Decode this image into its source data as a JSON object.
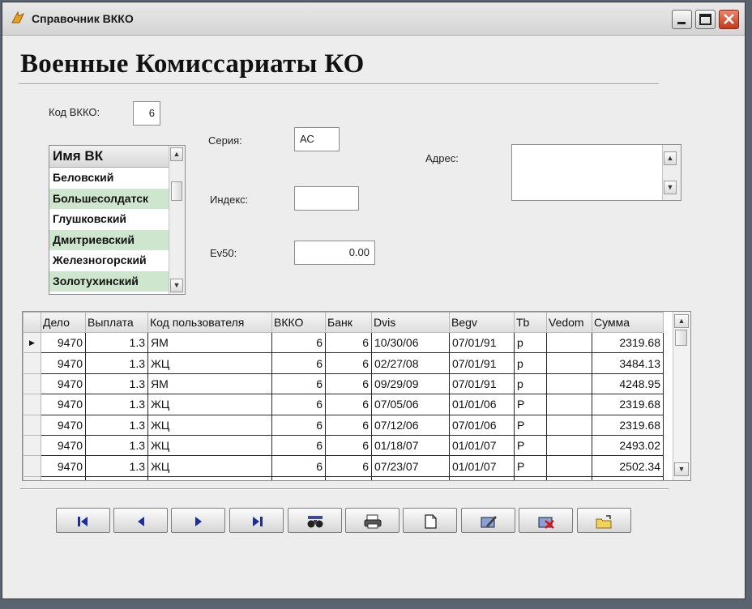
{
  "window": {
    "title": "Справочник ВККО",
    "icons": {
      "app": "app-flame-icon",
      "minimize": "minimize-icon",
      "maximize": "maximize-icon",
      "close": "close-icon"
    }
  },
  "form": {
    "heading": "Военные Комиссариаты КО",
    "code_label": "Код ВККО:",
    "code_value": "6",
    "series_label": "Серия:",
    "series_value": "АС",
    "index_label": "Индекс:",
    "index_value": "",
    "ev50_label": "Ev50:",
    "ev50_value": "0.00",
    "address_label": "Адрес:",
    "address_value": ""
  },
  "vk_list": {
    "header": "Имя ВК",
    "items": [
      "Беловский",
      "Большесолдатск",
      "Глушковский",
      "Дмитриевский",
      "Железногорский",
      "Золотухинский"
    ]
  },
  "grid": {
    "columns": [
      "Дело",
      "Выплата",
      "Код пользователя",
      "ВККО",
      "Банк",
      "Dvis",
      "Begv",
      "Tb",
      "Vedom",
      "Сумма"
    ],
    "rows": [
      [
        "9470",
        "1.3",
        "ЯМ",
        "6",
        "6",
        "10/30/06",
        "07/01/91",
        "р",
        "",
        "2319.68"
      ],
      [
        "9470",
        "1.3",
        "ЖЦ",
        "6",
        "6",
        "02/27/08",
        "07/01/91",
        "р",
        "",
        "3484.13"
      ],
      [
        "9470",
        "1.3",
        "ЯМ",
        "6",
        "6",
        "09/29/09",
        "07/01/91",
        "р",
        "",
        "4248.95"
      ],
      [
        "9470",
        "1.3",
        "ЖЦ",
        "6",
        "6",
        "07/05/06",
        "01/01/06",
        "Р",
        "",
        "2319.68"
      ],
      [
        "9470",
        "1.3",
        "ЖЦ",
        "6",
        "6",
        "07/12/06",
        "07/01/06",
        "Р",
        "",
        "2319.68"
      ],
      [
        "9470",
        "1.3",
        "ЖЦ",
        "6",
        "6",
        "01/18/07",
        "01/01/07",
        "Р",
        "",
        "2493.02"
      ],
      [
        "9470",
        "1.3",
        "ЖЦ",
        "6",
        "6",
        "07/23/07",
        "01/01/07",
        "Р",
        "",
        "2502.34"
      ],
      [
        "",
        "",
        "",
        "",
        "",
        "",
        "",
        "",
        "",
        ""
      ]
    ]
  },
  "toolbar": {
    "buttons": [
      {
        "name": "first-record-button",
        "icon": "first-record-icon"
      },
      {
        "name": "prev-record-button",
        "icon": "prev-record-icon"
      },
      {
        "name": "next-record-button",
        "icon": "next-record-icon"
      },
      {
        "name": "last-record-button",
        "icon": "last-record-icon"
      },
      {
        "name": "find-button",
        "icon": "binoculars-icon"
      },
      {
        "name": "print-button",
        "icon": "printer-icon"
      },
      {
        "name": "new-record-button",
        "icon": "new-document-icon"
      },
      {
        "name": "edit-record-button",
        "icon": "edit-icon"
      },
      {
        "name": "delete-record-button",
        "icon": "delete-icon"
      },
      {
        "name": "exit-button",
        "icon": "folder-icon"
      }
    ]
  },
  "colors": {
    "list_alt_row": "#cde6cd",
    "window_bg": "#ededed",
    "close_button": "#c4391c"
  }
}
